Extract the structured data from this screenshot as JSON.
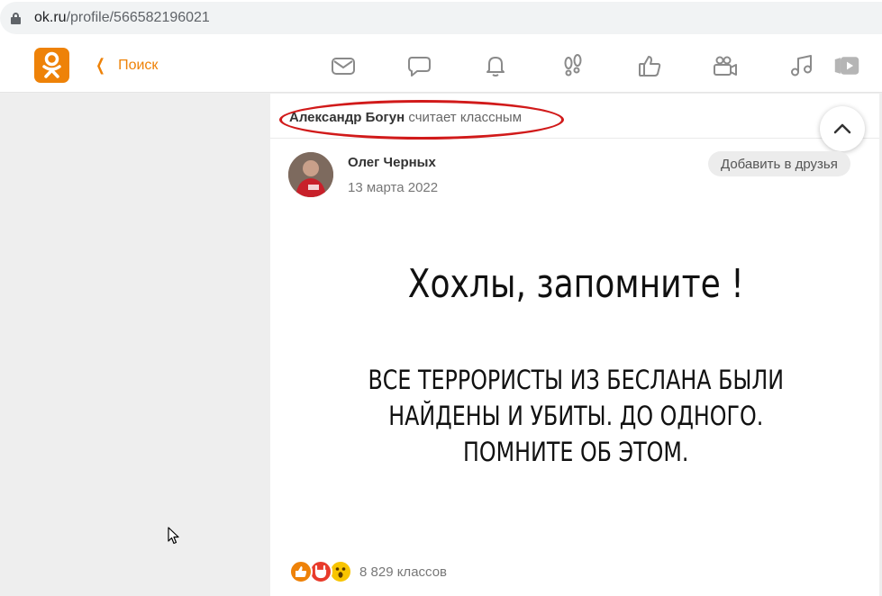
{
  "browser": {
    "url_host": "ok.ru",
    "url_path": "/profile/566582196021"
  },
  "topnav": {
    "back_label": "Поиск",
    "icons": [
      "mail-icon",
      "chat-icon",
      "bell-icon",
      "footprints-icon",
      "thumbs-up-icon",
      "video-camera-icon",
      "music-icon",
      "video-play-icon"
    ]
  },
  "activity": {
    "actor": "Александр Богун",
    "verb": "считает классным"
  },
  "post": {
    "author": "Олег Черных",
    "date": "13 марта 2022",
    "add_friend_label": "Добавить в друзья",
    "image_headline": "Хохлы, запомните !",
    "image_body_line1": "ВСЕ ТЕРРОРИСТЫ ИЗ БЕСЛАНА БЫЛИ",
    "image_body_line2": "НАЙДЕНЫ И УБИТЫ. ДО ОДНОГО.",
    "image_body_line3": "ПОМНИТЕ ОБ ЭТОМ.",
    "classes_count": "8 829 классов"
  },
  "colors": {
    "ok_orange": "#ee8208",
    "highlight_red": "#d11a1a"
  }
}
